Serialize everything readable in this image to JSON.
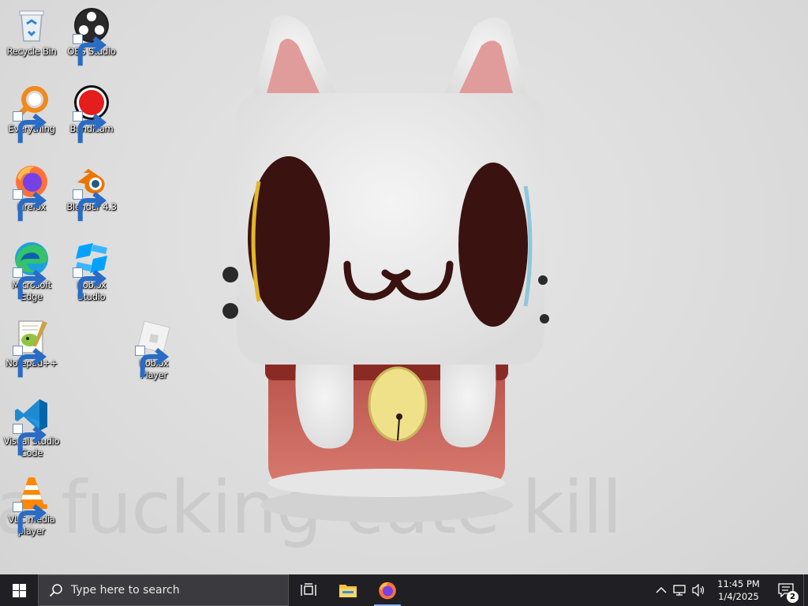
{
  "wallpaper": {
    "caption": "a fucking cute kill"
  },
  "desktop": {
    "icons": [
      {
        "label": "Recycle Bin",
        "icon": "recycle-bin-icon",
        "shortcut": false
      },
      {
        "label": "OBS Studio",
        "icon": "obs-icon",
        "shortcut": true
      },
      {
        "label": "Everything",
        "icon": "everything-icon",
        "shortcut": true
      },
      {
        "label": "Bandicam",
        "icon": "bandicam-icon",
        "shortcut": true
      },
      {
        "label": "Firefox",
        "icon": "firefox-icon",
        "shortcut": true
      },
      {
        "label": "Blender 4.3",
        "icon": "blender-icon",
        "shortcut": true
      },
      {
        "label": "Microsoft Edge",
        "icon": "edge-icon",
        "shortcut": true
      },
      {
        "label": "Roblox Studio",
        "icon": "roblox-studio-icon",
        "shortcut": true
      },
      {
        "label": "Notepad++",
        "icon": "notepadpp-icon",
        "shortcut": true
      },
      {
        "label": "Roblox Player",
        "icon": "roblox-player-icon",
        "shortcut": true
      },
      {
        "label": "Visual Studio Code",
        "icon": "vscode-icon",
        "shortcut": true
      },
      {
        "label": "VLC media player",
        "icon": "vlc-icon",
        "shortcut": true
      }
    ]
  },
  "taskbar": {
    "search_placeholder": "Type here to search",
    "pinned": [
      {
        "name": "Task View",
        "icon": "task-view-icon"
      },
      {
        "name": "File Explorer",
        "icon": "folder-icon"
      },
      {
        "name": "Firefox",
        "icon": "firefox-icon",
        "active": true
      }
    ],
    "clock": {
      "time": "11:45 PM",
      "date": "1/4/2025"
    },
    "notifications": {
      "count": "2"
    }
  },
  "colors": {
    "taskbar": "#202024",
    "search_box": "#3b3b3f",
    "mascot_white": "#ededed",
    "mascot_red": "#c8605a",
    "bell_yellow": "#efe08a",
    "eye_dark": "#3a1210"
  }
}
